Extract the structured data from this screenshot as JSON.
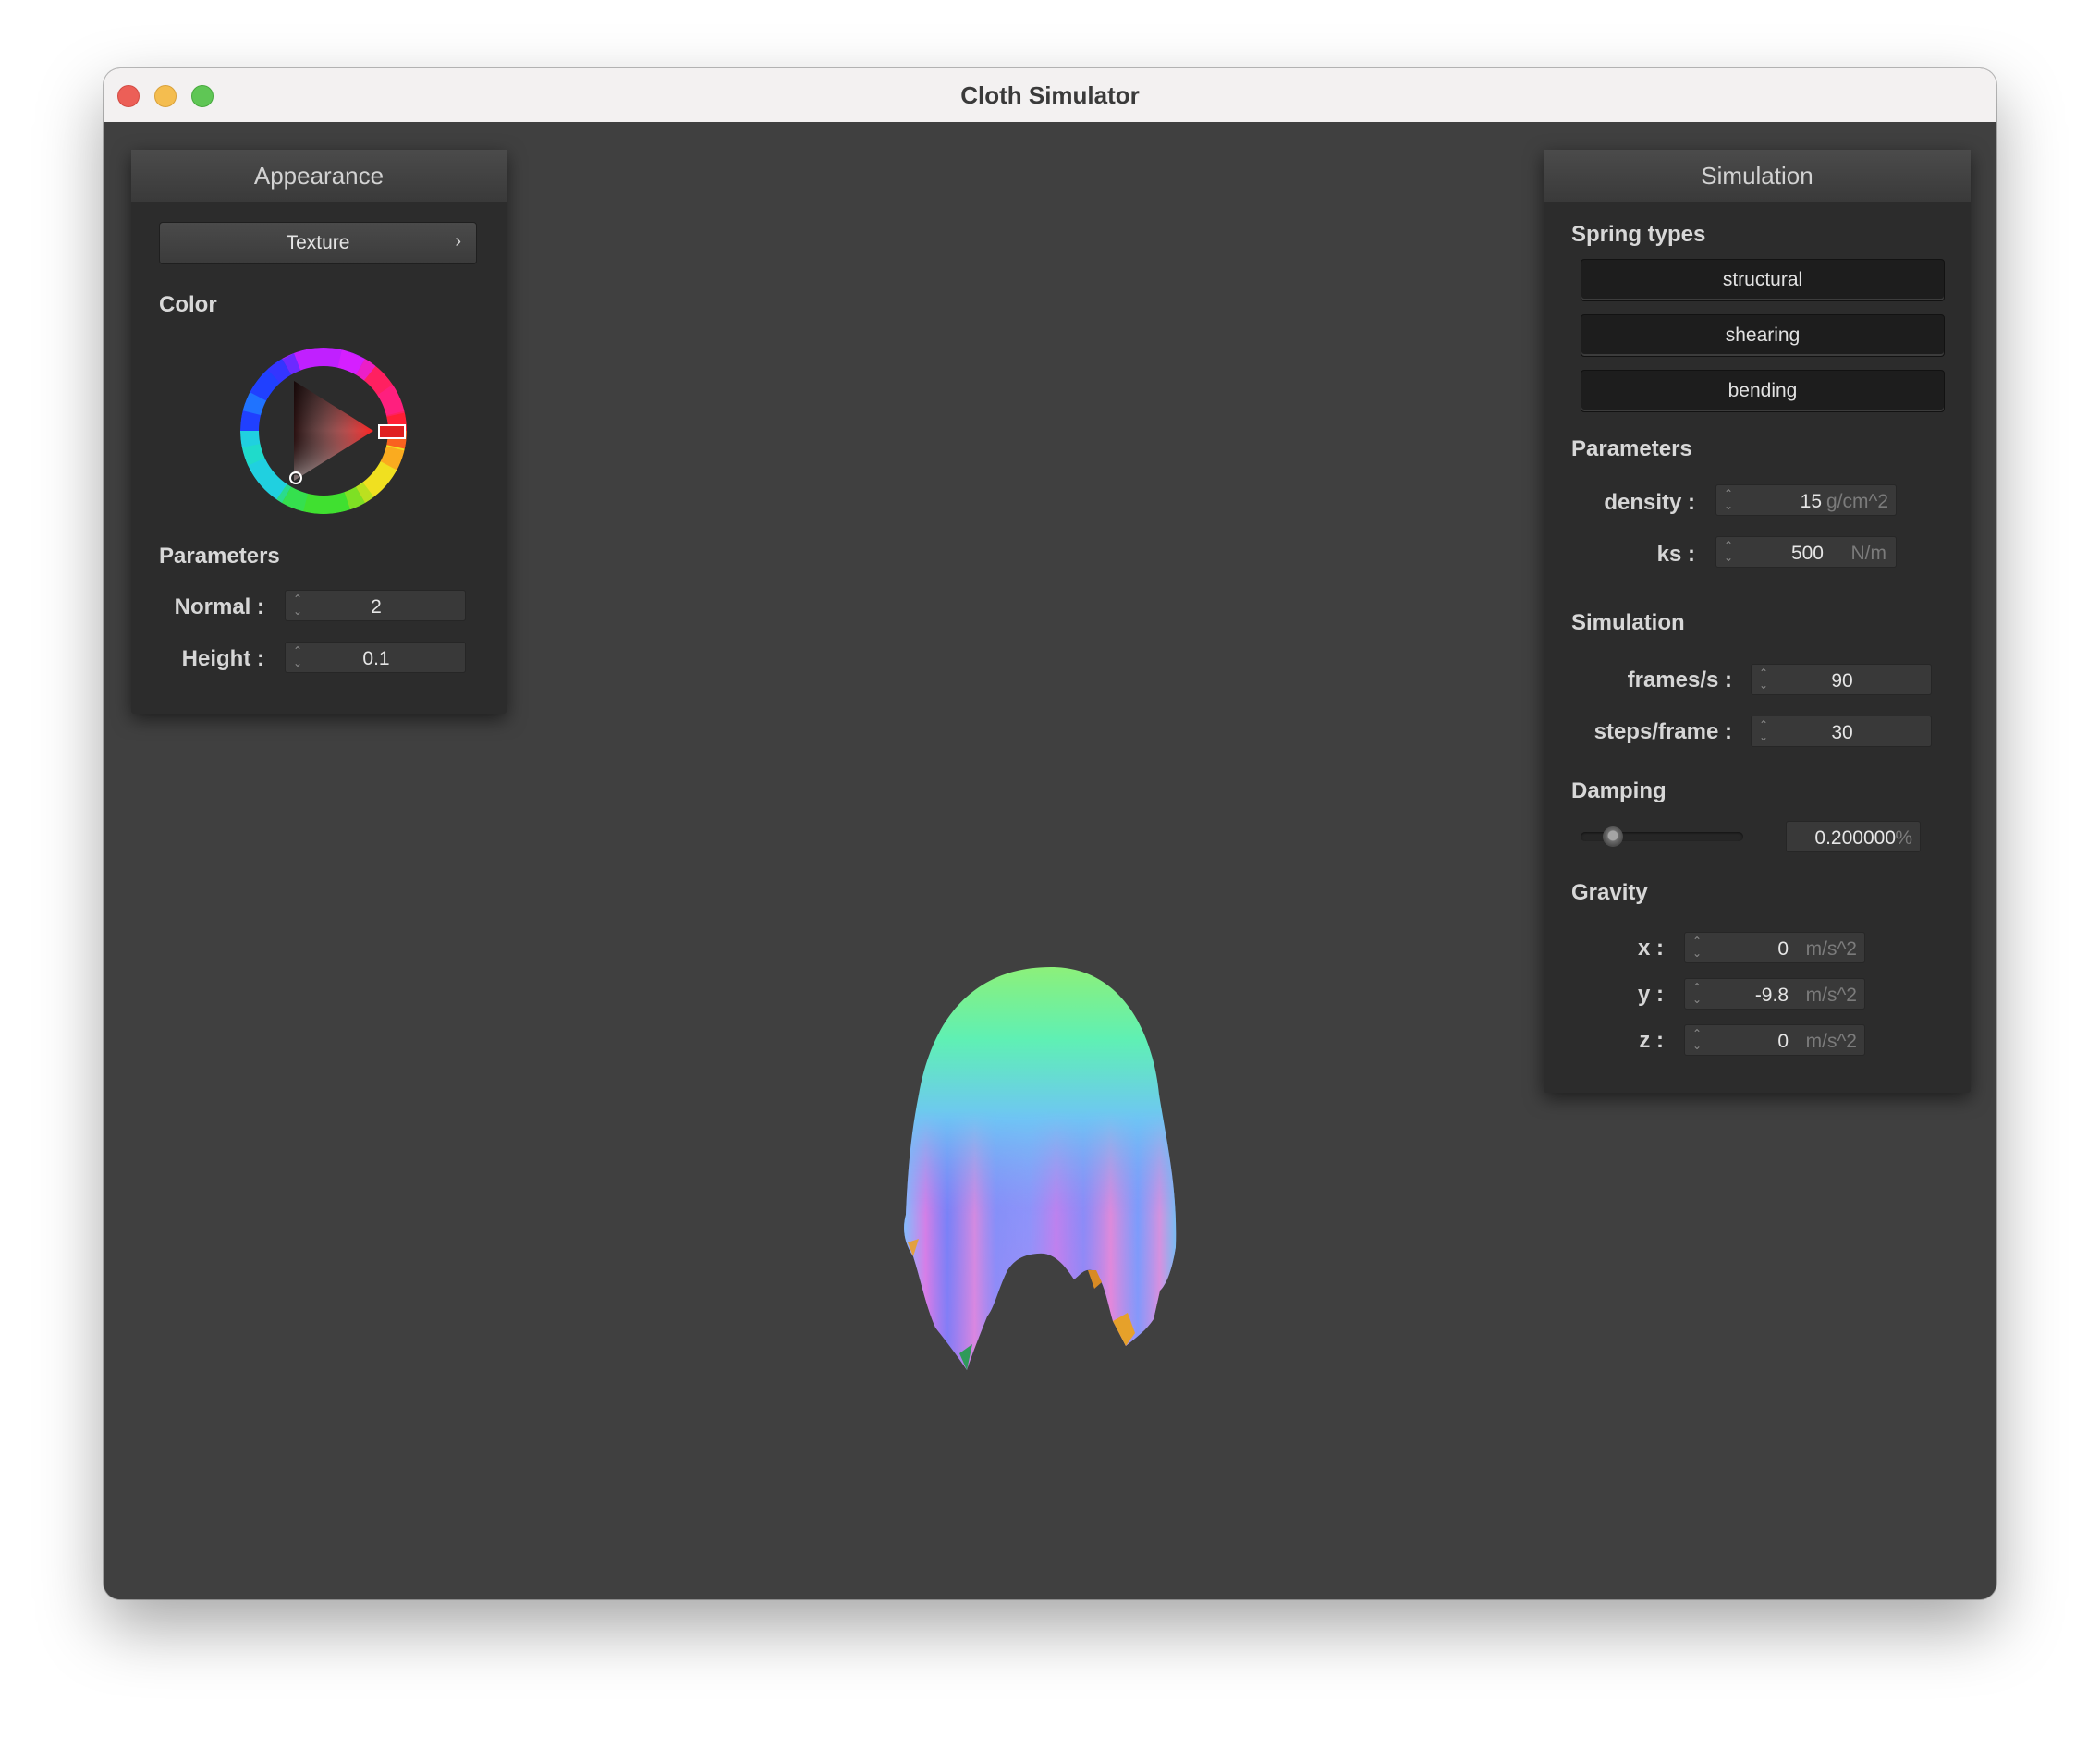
{
  "window": {
    "title": "Cloth Simulator"
  },
  "appearance": {
    "header": "Appearance",
    "texture_button": "Texture",
    "color_label": "Color",
    "parameters_label": "Parameters",
    "normal_label": "Normal :",
    "normal_value": "2",
    "height_label": "Height :",
    "height_value": "0.1",
    "selected_color": "#e02020"
  },
  "simulation": {
    "header": "Simulation",
    "spring_types_label": "Spring types",
    "spring_buttons": [
      "structural",
      "shearing",
      "bending"
    ],
    "parameters_label": "Parameters",
    "density_label": "density :",
    "density_value": "15",
    "density_unit": "g/cm^2",
    "ks_label": "ks :",
    "ks_value": "500",
    "ks_unit": "N/m",
    "simulation_label": "Simulation",
    "fps_label": "frames/s :",
    "fps_value": "90",
    "steps_label": "steps/frame :",
    "steps_value": "30",
    "damping_label": "Damping",
    "damping_value": "0.200000",
    "damping_unit": "%",
    "damping_fraction": 0.2,
    "gravity_label": "Gravity",
    "gx_label": "x :",
    "gx_value": "0",
    "gy_label": "y :",
    "gy_value": "-9.8",
    "gz_label": "z :",
    "gz_value": "0",
    "gravity_unit": "m/s^2"
  }
}
